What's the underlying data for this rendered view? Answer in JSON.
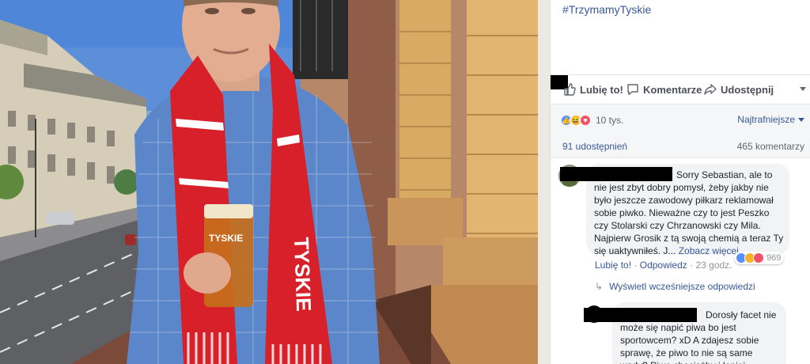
{
  "post": {
    "top_partial_text": "",
    "hashtag": "#TrzymamyTyskie"
  },
  "actions": {
    "like_label": "Lubię to!",
    "comment_label": "Komentarze",
    "share_label": "Udostępnij"
  },
  "stats": {
    "reaction_count": "10 tys.",
    "sort_label": "Najtrafniejsze",
    "shares_label": "91 udostępnień",
    "comments_label": "465 komentarzy"
  },
  "comments": [
    {
      "text": "Sorry Sebastian, ale to nie jest zbyt dobry pomysł, żeby jakby nie było jeszcze zawodowy piłkarz reklamował sobie piwko. Nieważne czy to jest Peszko czy Stolarski czy Chrzanowski czy Mila. Najpierw Grosik z tą swoją chemią a teraz Ty się uaktywniłeś. J...",
      "see_more": "Zobacz więcej",
      "reaction_count": "969",
      "like_action": "Lubię to!",
      "reply_action": "Odpowiedz",
      "time": "23 godz."
    },
    {
      "text": "Dorosły facet nie może się napić piwa bo jest sportowcem? xD A zdajesz sobie sprawę, że piwo to nie są same wady? Piwo chociażby i lepiej"
    }
  ],
  "view_previous_replies": "Wyświetl wcześniejsze odpowiedzi",
  "photo": {
    "scarf_text": "TYSKIE",
    "glass_text": "TYSKIE"
  },
  "colors": {
    "link": "#385898",
    "scarf_red": "#d8202a",
    "shirt_blue": "#5b86c9"
  }
}
